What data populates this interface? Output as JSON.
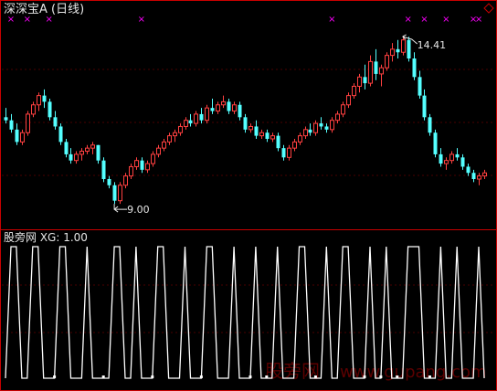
{
  "colors": {
    "background": "#000000",
    "frame": "#c80000",
    "grid": "#4a0000",
    "up": "#ff4040",
    "down": "#54ffff",
    "marker": "#ff00ff",
    "signal": "#ffffff",
    "title": "#e6e6e6",
    "watermark": "#5c0000"
  },
  "price_panel": {
    "title": "深深宝A (日线)",
    "high_label": "14.41",
    "low_label": "9.00",
    "corner_icon": "diamond-icon"
  },
  "indicator_panel": {
    "title": "股旁网 XG: 1.00"
  },
  "watermark": {
    "brand": "股旁网",
    "url": "www.gupang.com"
  },
  "chart_data": [
    {
      "type": "candlestick",
      "title": "深深宝A (日线)",
      "ylim": [
        8.5,
        15.0
      ],
      "annotations": [
        {
          "label": "14.41",
          "kind": "high",
          "value": 14.41
        },
        {
          "label": "9.00",
          "kind": "low",
          "value": 9.0
        }
      ],
      "marker_indices": [
        1,
        4,
        8,
        25,
        60,
        74,
        77,
        81,
        86,
        87
      ],
      "candles": [
        [
          11.8,
          12.1,
          11.6,
          11.7
        ],
        [
          11.7,
          11.9,
          11.3,
          11.4
        ],
        [
          11.4,
          11.6,
          10.9,
          11.0
        ],
        [
          11.0,
          11.4,
          10.9,
          11.3
        ],
        [
          11.3,
          12.0,
          11.2,
          11.9
        ],
        [
          11.9,
          12.3,
          11.8,
          12.2
        ],
        [
          12.2,
          12.6,
          12.0,
          12.5
        ],
        [
          12.5,
          12.7,
          12.1,
          12.3
        ],
        [
          12.3,
          12.4,
          11.7,
          11.8
        ],
        [
          11.8,
          12.0,
          11.4,
          11.5
        ],
        [
          11.5,
          11.6,
          10.9,
          11.0
        ],
        [
          11.0,
          11.1,
          10.5,
          10.6
        ],
        [
          10.6,
          10.8,
          10.3,
          10.4
        ],
        [
          10.4,
          10.7,
          10.3,
          10.6
        ],
        [
          10.6,
          10.8,
          10.4,
          10.7
        ],
        [
          10.7,
          10.9,
          10.6,
          10.8
        ],
        [
          10.8,
          11.0,
          10.6,
          10.9
        ],
        [
          10.9,
          10.9,
          10.3,
          10.4
        ],
        [
          10.4,
          10.5,
          9.7,
          9.8
        ],
        [
          9.8,
          9.9,
          9.5,
          9.6
        ],
        [
          9.6,
          9.7,
          9.0,
          9.1
        ],
        [
          9.1,
          9.7,
          9.0,
          9.6
        ],
        [
          9.6,
          10.0,
          9.5,
          9.9
        ],
        [
          9.9,
          10.3,
          9.8,
          10.2
        ],
        [
          10.2,
          10.5,
          10.1,
          10.4
        ],
        [
          10.4,
          10.5,
          10.0,
          10.1
        ],
        [
          10.1,
          10.4,
          10.0,
          10.3
        ],
        [
          10.3,
          10.7,
          10.2,
          10.6
        ],
        [
          10.6,
          10.9,
          10.5,
          10.8
        ],
        [
          10.8,
          11.1,
          10.7,
          11.0
        ],
        [
          11.0,
          11.3,
          10.9,
          11.2
        ],
        [
          11.2,
          11.4,
          11.0,
          11.3
        ],
        [
          11.3,
          11.6,
          11.2,
          11.5
        ],
        [
          11.5,
          11.8,
          11.4,
          11.7
        ],
        [
          11.7,
          11.9,
          11.5,
          11.6
        ],
        [
          11.6,
          12.0,
          11.5,
          11.9
        ],
        [
          11.9,
          12.1,
          11.6,
          11.7
        ],
        [
          11.7,
          12.2,
          11.6,
          12.1
        ],
        [
          12.1,
          12.4,
          11.9,
          12.0
        ],
        [
          12.0,
          12.3,
          11.9,
          12.2
        ],
        [
          12.2,
          12.5,
          12.1,
          12.3
        ],
        [
          12.3,
          12.4,
          11.9,
          12.0
        ],
        [
          12.0,
          12.3,
          11.9,
          12.2
        ],
        [
          12.2,
          12.3,
          11.7,
          11.8
        ],
        [
          11.8,
          11.9,
          11.3,
          11.4
        ],
        [
          11.4,
          11.6,
          11.3,
          11.5
        ],
        [
          11.5,
          11.7,
          11.1,
          11.2
        ],
        [
          11.2,
          11.4,
          11.1,
          11.3
        ],
        [
          11.3,
          11.4,
          11.0,
          11.1
        ],
        [
          11.1,
          11.3,
          11.0,
          11.2
        ],
        [
          11.2,
          11.3,
          10.7,
          10.8
        ],
        [
          10.8,
          10.9,
          10.4,
          10.5
        ],
        [
          10.5,
          10.9,
          10.4,
          10.8
        ],
        [
          10.8,
          11.1,
          10.7,
          11.0
        ],
        [
          11.0,
          11.3,
          10.9,
          11.2
        ],
        [
          11.2,
          11.5,
          11.1,
          11.4
        ],
        [
          11.4,
          11.6,
          11.2,
          11.3
        ],
        [
          11.3,
          11.7,
          11.2,
          11.6
        ],
        [
          11.6,
          11.8,
          11.4,
          11.5
        ],
        [
          11.5,
          11.6,
          11.3,
          11.4
        ],
        [
          11.4,
          11.8,
          11.3,
          11.7
        ],
        [
          11.7,
          12.0,
          11.6,
          11.9
        ],
        [
          11.9,
          12.3,
          11.8,
          12.2
        ],
        [
          12.2,
          12.6,
          12.1,
          12.5
        ],
        [
          12.5,
          12.9,
          12.4,
          12.8
        ],
        [
          12.8,
          13.2,
          12.6,
          13.1
        ],
        [
          13.1,
          13.5,
          12.7,
          12.9
        ],
        [
          12.9,
          13.8,
          12.8,
          13.6
        ],
        [
          13.6,
          14.0,
          13.0,
          13.2
        ],
        [
          13.2,
          13.5,
          12.8,
          13.4
        ],
        [
          13.4,
          13.9,
          13.3,
          13.8
        ],
        [
          13.8,
          14.2,
          13.6,
          14.0
        ],
        [
          14.0,
          14.3,
          13.7,
          13.9
        ],
        [
          13.9,
          14.41,
          13.8,
          14.3
        ],
        [
          14.3,
          14.4,
          13.6,
          13.7
        ],
        [
          13.7,
          13.9,
          13.0,
          13.1
        ],
        [
          13.1,
          13.3,
          12.4,
          12.5
        ],
        [
          12.5,
          12.7,
          11.7,
          11.8
        ],
        [
          11.8,
          11.9,
          11.2,
          11.3
        ],
        [
          11.3,
          11.4,
          10.5,
          10.6
        ],
        [
          10.6,
          10.8,
          10.2,
          10.3
        ],
        [
          10.3,
          10.5,
          10.1,
          10.4
        ],
        [
          10.4,
          10.7,
          10.3,
          10.6
        ],
        [
          10.6,
          10.8,
          10.4,
          10.5
        ],
        [
          10.5,
          10.6,
          10.1,
          10.2
        ],
        [
          10.2,
          10.3,
          9.9,
          10.0
        ],
        [
          10.0,
          10.1,
          9.7,
          9.8
        ],
        [
          9.8,
          10.0,
          9.6,
          9.9
        ],
        [
          9.9,
          10.1,
          9.8,
          10.0
        ]
      ]
    },
    {
      "type": "line",
      "title": "股旁网 XG: 1.00",
      "ylim": [
        0,
        1
      ],
      "series": [
        {
          "values": [
            0,
            1,
            1,
            0,
            0,
            1,
            1,
            0,
            0,
            0,
            1,
            1,
            0,
            0,
            0,
            1,
            0,
            0,
            0,
            0,
            1,
            1,
            0,
            0,
            1,
            0,
            0,
            0,
            1,
            1,
            0,
            0,
            0,
            1,
            0,
            0,
            0,
            1,
            1,
            0,
            0,
            0,
            1,
            0,
            0,
            0,
            1,
            0,
            0,
            0,
            1,
            0,
            0,
            0,
            1,
            1,
            0,
            0,
            0,
            1,
            0,
            0,
            1,
            1,
            0,
            0,
            0,
            1,
            0,
            0,
            1,
            0,
            0,
            0,
            1,
            1,
            1,
            0,
            0,
            0,
            1,
            0,
            0,
            1,
            0,
            0,
            0,
            1,
            0
          ]
        }
      ]
    }
  ]
}
